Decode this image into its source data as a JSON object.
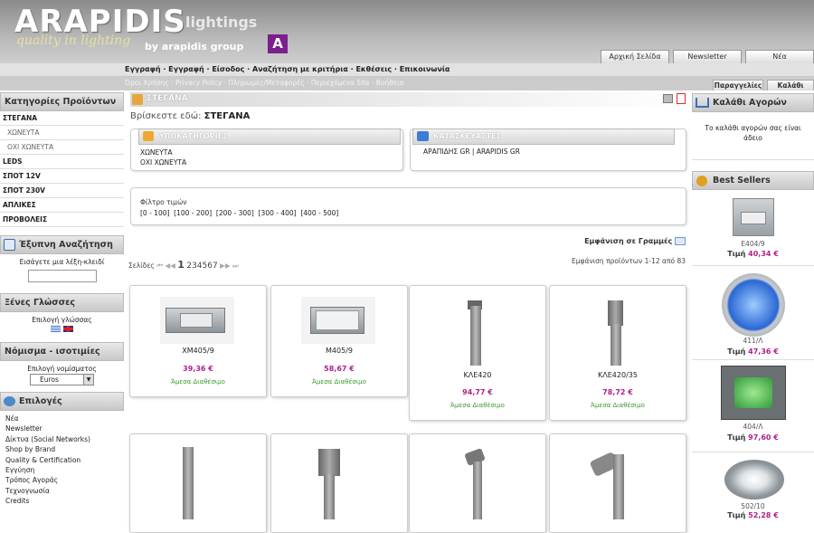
{
  "brand": {
    "name": "ARAPIDIS",
    "sub": "lightings",
    "tagline": "quality in lighting",
    "group": "by arapidis group",
    "badge": "A"
  },
  "toptabs": [
    "Αρχική Σελίδα",
    "Newsletter",
    "Νέα"
  ],
  "nav_main": [
    "Εγγραφή",
    "Εγγραφή",
    "Είσοδος",
    "Αναζήτηση με κριτήρια",
    "Εκθέσεις",
    "Επικοινωνία"
  ],
  "nav_sub": [
    "Όροι Χρήσης",
    "Privacy Policy",
    "Πληρωμές/Μεταφορές",
    "Περιεχόμενα Site",
    "Βοήθεια"
  ],
  "subtabs": [
    "Παραγγελίες",
    "Καλάθι"
  ],
  "categories": {
    "title": "Κατηγορίες Προϊόντων",
    "items": [
      "ΣΤΕΓΑΝΑ",
      "ΧΩΝΕΥΤΑ",
      "ΟΧΙ ΧΩΝΕΥΤΑ",
      "LEDS",
      "ΣΠΟΤ 12V",
      "ΣΠΟΤ 230V",
      "ΑΠΛΙΚΕΣ",
      "ΠΡΟΒΟΛΕΙΣ"
    ]
  },
  "search": {
    "title": "Έξυπνη Αναζήτηση",
    "label": "Εισάγετε μια λέξη-κλειδί"
  },
  "languages": {
    "title": "Ξένες Γλώσσες",
    "label": "Επιλογή γλώσσας"
  },
  "currency": {
    "title": "Νόμισμα - ισοτιμίες",
    "label": "Επιλογή νομίσματος",
    "selected": "Euros"
  },
  "options": {
    "title": "Επιλογές",
    "items": [
      "Νέα",
      "Newsletter",
      "Δίκτυα (Social Networks)",
      "Shop by Brand",
      "Quality & Certification",
      "Εγγύηση",
      "Τρόπος Αγοράς",
      "Τεχνογνωσία",
      "Credits"
    ]
  },
  "page": {
    "title": "ΣΤΕΓΑΝΑ",
    "breadcrumb_label": "Βρίσκεστε εδώ:",
    "breadcrumb_value": "ΣΤΕΓΑΝΑ",
    "subcats_title": "ΥΠΟΚΑΤΗΓΟΡΙΕΣ",
    "subcats": [
      "ΧΩΝΕΥΤΑ",
      "ΟΧΙ ΧΩΝΕΥΤΑ"
    ],
    "makers_title": "ΚΑΤΑΣΚΕΥΑΣΤΕΣ",
    "makers": "ΑΡΑΠΙΔΗΣ GR | ARAPIDIS GR",
    "price_filter_label": "Φίλτρο τιμών",
    "price_filters": "[0 - 100]  [100 - 200]  [200 - 300]  [300 - 400]  [400 - 500]",
    "view_rows": "Εμφάνιση σε Γραμμές",
    "pages_label": "Σελίδες",
    "page_current": "1",
    "page_others": "234567",
    "showing": "Εμφάνιση προϊόντων 1-12 από 83"
  },
  "products": [
    {
      "name": "XM405/9",
      "price": "39,36 €",
      "avail": "Άμεσα Διαθέσιμο",
      "icon": "recessed-rect-light"
    },
    {
      "name": "M405/9",
      "price": "58,67 €",
      "avail": "Άμεσα Διαθέσιμο",
      "icon": "recessed-rect-light"
    },
    {
      "name": "ΚΛΕ420",
      "price": "94,77 €",
      "avail": "Άμεσα Διαθέσιμο",
      "icon": "bollard-light"
    },
    {
      "name": "ΚΛΕ420/35",
      "price": "78,72 €",
      "avail": "Άμεσα Διαθέσιμο",
      "icon": "bollard-light"
    }
  ],
  "cart": {
    "title": "Καλάθι Αγορών",
    "text": "Το καλάθι αγορών σας είναι άδειο"
  },
  "bestsellers": {
    "title": "Best Sellers",
    "price_label": "Τιμή",
    "items": [
      {
        "code": "E404/9",
        "price": "40,34 €"
      },
      {
        "code": "411/Λ",
        "price": "47,36 €"
      },
      {
        "code": "404/Λ",
        "price": "97,60 €"
      },
      {
        "code": "502/10",
        "price": "52,28 €"
      }
    ]
  },
  "colors": {
    "accent": "#b0208c",
    "avail": "#3a9a2a",
    "brand_badge": "#7a1f8c"
  }
}
